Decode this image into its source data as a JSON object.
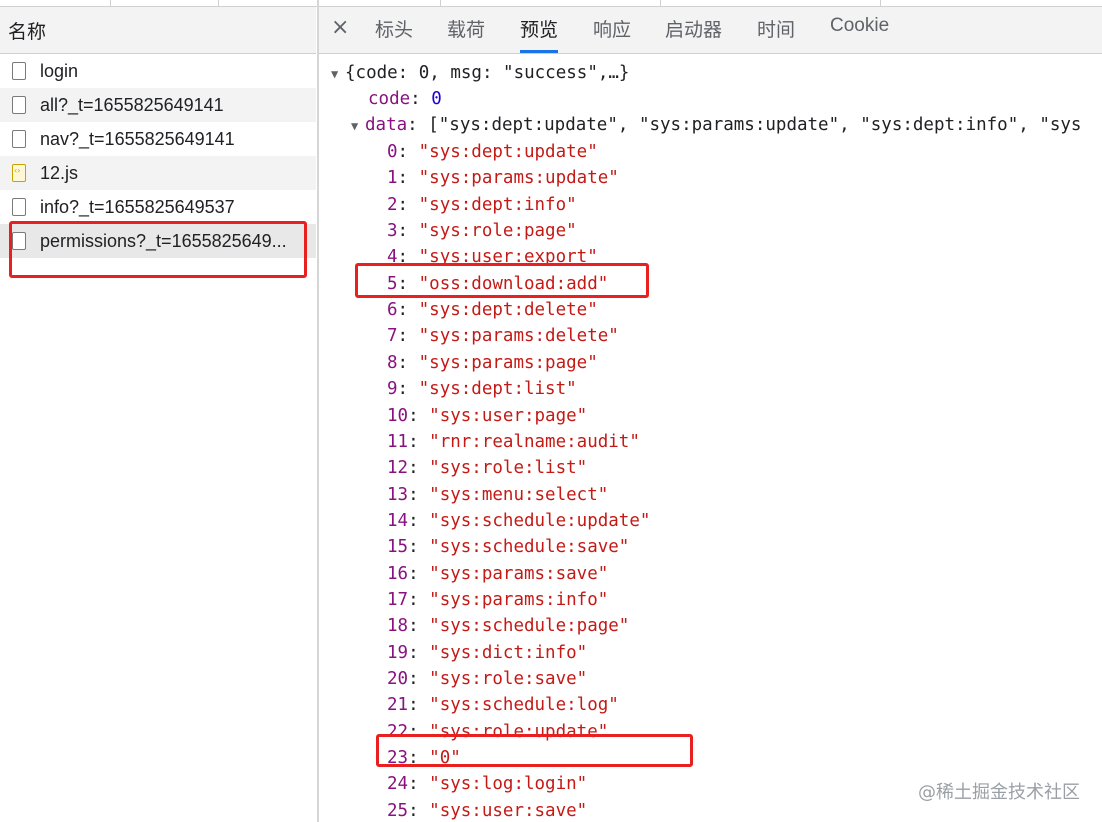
{
  "left_panel": {
    "header": "名称",
    "requests": [
      {
        "name": "login",
        "icon": "document-icon"
      },
      {
        "name": "all?_t=1655825649141",
        "icon": "document-icon"
      },
      {
        "name": "nav?_t=1655825649141",
        "icon": "document-icon"
      },
      {
        "name": "12.js",
        "icon": "script-icon"
      },
      {
        "name": "info?_t=1655825649537",
        "icon": "document-icon"
      },
      {
        "name": "permissions?_t=1655825649...",
        "icon": "document-icon"
      }
    ]
  },
  "tabs": {
    "close": "×",
    "items": [
      "标头",
      "载荷",
      "预览",
      "响应",
      "启动器",
      "时间",
      "Cookie"
    ],
    "active": "预览"
  },
  "preview": {
    "root_summary": "{code: 0, msg: \"success\",…}",
    "code_key": "code",
    "code_value": "0",
    "data_key": "data",
    "data_summary": "[\"sys:dept:update\", \"sys:params:update\", \"sys:dept:info\", \"sys",
    "items": [
      {
        "index": "0",
        "value": "\"sys:dept:update\""
      },
      {
        "index": "1",
        "value": "\"sys:params:update\""
      },
      {
        "index": "2",
        "value": "\"sys:dept:info\""
      },
      {
        "index": "3",
        "value": "\"sys:role:page\""
      },
      {
        "index": "4",
        "value": "\"sys:user:export\""
      },
      {
        "index": "5",
        "value": "\"oss:download:add\""
      },
      {
        "index": "6",
        "value": "\"sys:dept:delete\""
      },
      {
        "index": "7",
        "value": "\"sys:params:delete\""
      },
      {
        "index": "8",
        "value": "\"sys:params:page\""
      },
      {
        "index": "9",
        "value": "\"sys:dept:list\""
      },
      {
        "index": "10",
        "value": "\"sys:user:page\""
      },
      {
        "index": "11",
        "value": "\"rnr:realname:audit\""
      },
      {
        "index": "12",
        "value": "\"sys:role:list\""
      },
      {
        "index": "13",
        "value": "\"sys:menu:select\""
      },
      {
        "index": "14",
        "value": "\"sys:schedule:update\""
      },
      {
        "index": "15",
        "value": "\"sys:schedule:save\""
      },
      {
        "index": "16",
        "value": "\"sys:params:save\""
      },
      {
        "index": "17",
        "value": "\"sys:params:info\""
      },
      {
        "index": "18",
        "value": "\"sys:schedule:page\""
      },
      {
        "index": "19",
        "value": "\"sys:dict:info\""
      },
      {
        "index": "20",
        "value": "\"sys:role:save\""
      },
      {
        "index": "21",
        "value": "\"sys:schedule:log\""
      },
      {
        "index": "22",
        "value": "\"sys:role:update\""
      },
      {
        "index": "23",
        "value": "\"0\""
      },
      {
        "index": "24",
        "value": "\"sys:log:login\""
      },
      {
        "index": "25",
        "value": "\"sys:user:save\""
      }
    ]
  },
  "watermark": "@稀土掘金技术社区",
  "colors": {
    "highlight_box": "#e8201f",
    "active_tab_underline": "#1a73e8",
    "json_key": "#881280",
    "json_string": "#c41a16",
    "json_number": "#1c00cf"
  }
}
